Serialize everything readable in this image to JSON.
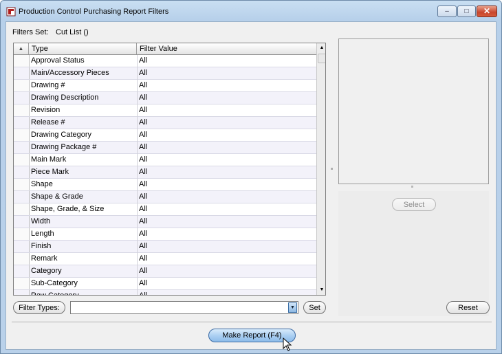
{
  "window": {
    "title": "Production Control Purchasing Report Filters",
    "controls": {
      "minimize": "–",
      "maximize": "□",
      "close": "✕"
    }
  },
  "filters_set": {
    "label": "Filters Set:",
    "value": "Cut List ()"
  },
  "table": {
    "sort_indicator": "▲",
    "columns": [
      "Type",
      "Filter Value"
    ],
    "rows": [
      {
        "type": "Approval Status",
        "value": "All"
      },
      {
        "type": "Main/Accessory Pieces",
        "value": "All"
      },
      {
        "type": "Drawing #",
        "value": "All"
      },
      {
        "type": "Drawing Description",
        "value": "All"
      },
      {
        "type": "Revision",
        "value": "All"
      },
      {
        "type": "Release #",
        "value": "All"
      },
      {
        "type": "Drawing Category",
        "value": "All"
      },
      {
        "type": "Drawing Package #",
        "value": "All"
      },
      {
        "type": "Main Mark",
        "value": "All"
      },
      {
        "type": "Piece Mark",
        "value": "All"
      },
      {
        "type": "Shape",
        "value": "All"
      },
      {
        "type": "Shape & Grade",
        "value": "All"
      },
      {
        "type": "Shape, Grade, & Size",
        "value": "All"
      },
      {
        "type": "Width",
        "value": "All"
      },
      {
        "type": "Length",
        "value": "All"
      },
      {
        "type": "Finish",
        "value": "All"
      },
      {
        "type": "Remark",
        "value": "All"
      },
      {
        "type": "Category",
        "value": "All"
      },
      {
        "type": "Sub-Category",
        "value": "All"
      },
      {
        "type": "Raw Category",
        "value": "All"
      }
    ],
    "scroll_up": "▲",
    "scroll_down": "▼"
  },
  "controls": {
    "filter_types_label": "Filter Types:",
    "combo_value": "",
    "combo_arrow": "▼",
    "set_label": "Set",
    "select_label": "Select",
    "reset_label": "Reset",
    "make_report_label": "Make Report (F4)"
  },
  "colors": {
    "title_gradient_top": "#c9dff2",
    "make_report_button": "#a9cef2",
    "close_button": "#c8452d"
  }
}
